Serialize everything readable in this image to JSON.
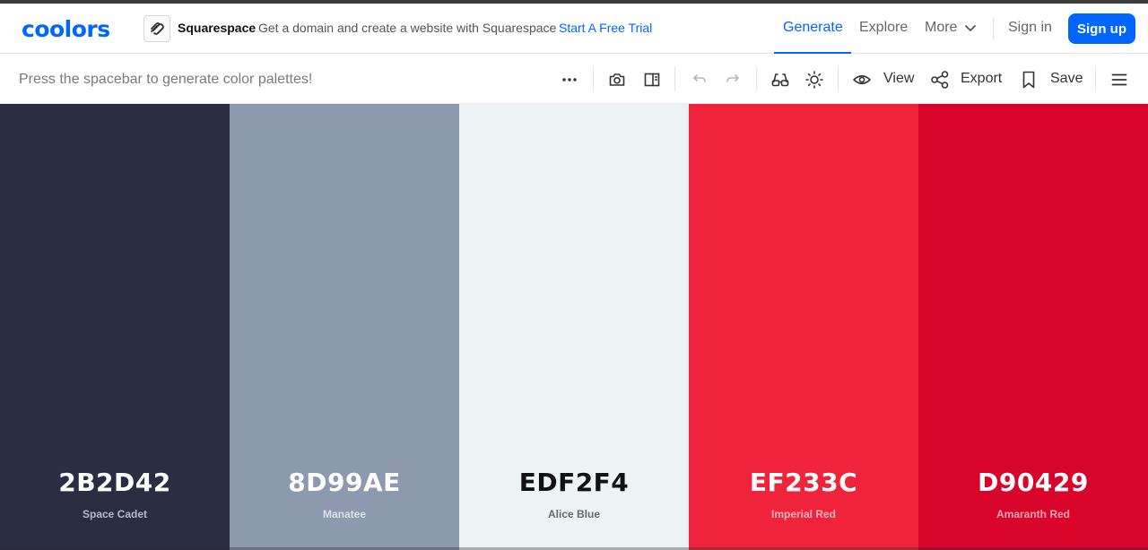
{
  "header": {
    "logo": "coolors",
    "ad": {
      "brand": "Squarespace",
      "text": "Get a domain and create a website with Squarespace",
      "cta": "Start A Free Trial"
    },
    "nav": {
      "generate": "Generate",
      "explore": "Explore",
      "more": "More",
      "sign_in": "Sign in",
      "sign_up": "Sign up"
    },
    "accent": "#0066ff"
  },
  "toolbar": {
    "hint": "Press the spacebar to generate color palettes!",
    "icons": [
      "more-options-icon",
      "camera-icon",
      "sidebar-panel-icon",
      "undo-icon",
      "redo-icon",
      "glasses-icon",
      "sun-icon",
      "eye-icon",
      "share-icon",
      "bookmark-icon",
      "menu-icon"
    ],
    "view_label": "View",
    "export_label": "Export",
    "save_label": "Save"
  },
  "palette": [
    {
      "hex": "2B2D42",
      "name": "Space Cadet",
      "color": "#2B2D42",
      "text_color": "#ffffff",
      "name_color": "#b9bac4"
    },
    {
      "hex": "8D99AE",
      "name": "Manatee",
      "color": "#8D99AE",
      "text_color": "#ffffff",
      "name_color": "#dde1e8"
    },
    {
      "hex": "EDF2F4",
      "name": "Alice Blue",
      "color": "#EDF2F4",
      "text_color": "#111111",
      "name_color": "#666a70"
    },
    {
      "hex": "EF233C",
      "name": "Imperial Red",
      "color": "#EF233C",
      "text_color": "#ffffff",
      "name_color": "#f8b4bd"
    },
    {
      "hex": "D90429",
      "name": "Amaranth Red",
      "color": "#D90429",
      "text_color": "#ffffff",
      "name_color": "#f0a6b3"
    }
  ]
}
